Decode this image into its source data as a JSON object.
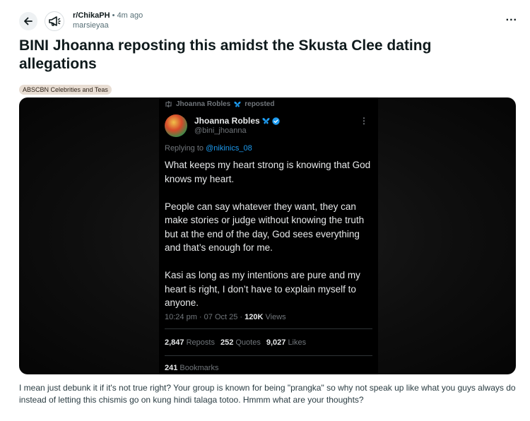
{
  "header": {
    "subreddit": "r/ChikaPH",
    "separator": "•",
    "time_ago": "4m ago",
    "username": "marsieyaa",
    "more_label": "..."
  },
  "post": {
    "title": "BINI Jhoanna reposting this amidst the Skusta Clee dating allegations",
    "flair": "ABSCBN Celebrities and Teas",
    "body": "I mean just debunk it if it's not true right? Your group is known for being \"prangka\" so why not speak up like what you guys always do instead of letting this chismis go on kung hindi talaga totoo. Hmmm what are your thoughts?"
  },
  "tweet": {
    "repost_by": "Jhoanna Robles",
    "repost_suffix": "reposted",
    "author_name": "Jhoanna Robles",
    "author_handle": "@bini_jhoanna",
    "replying_prefix": "Replying to",
    "replying_to": "@nikinics_08",
    "paragraphs": [
      "What keeps my heart strong is knowing that God knows my heart.",
      "People can say whatever they want, they can make stories or judge without knowing the truth but at the end of the day, God sees everything and that’s enough for me.",
      "Kasi as long as my intentions are pure and my heart is right, I don’t have to explain myself to anyone."
    ],
    "time": "10:24 pm",
    "date": "07 Oct 25",
    "views_count": "120K",
    "views_label": "Views",
    "reposts_count": "2,847",
    "reposts_label": "Reposts",
    "quotes_count": "252",
    "quotes_label": "Quotes",
    "likes_count": "9,027",
    "likes_label": "Likes",
    "bookmarks_count": "241",
    "bookmarks_label": "Bookmarks",
    "butterfly_color": "#1d9bf0",
    "verified_color": "#1d9bf0"
  },
  "icons": {
    "back": "arrow-left-icon",
    "subreddit": "megaphone-icon",
    "more": "more-dots-icon",
    "repost": "repost-icon",
    "verified": "verified-badge-icon",
    "butterfly": "butterfly-icon"
  }
}
